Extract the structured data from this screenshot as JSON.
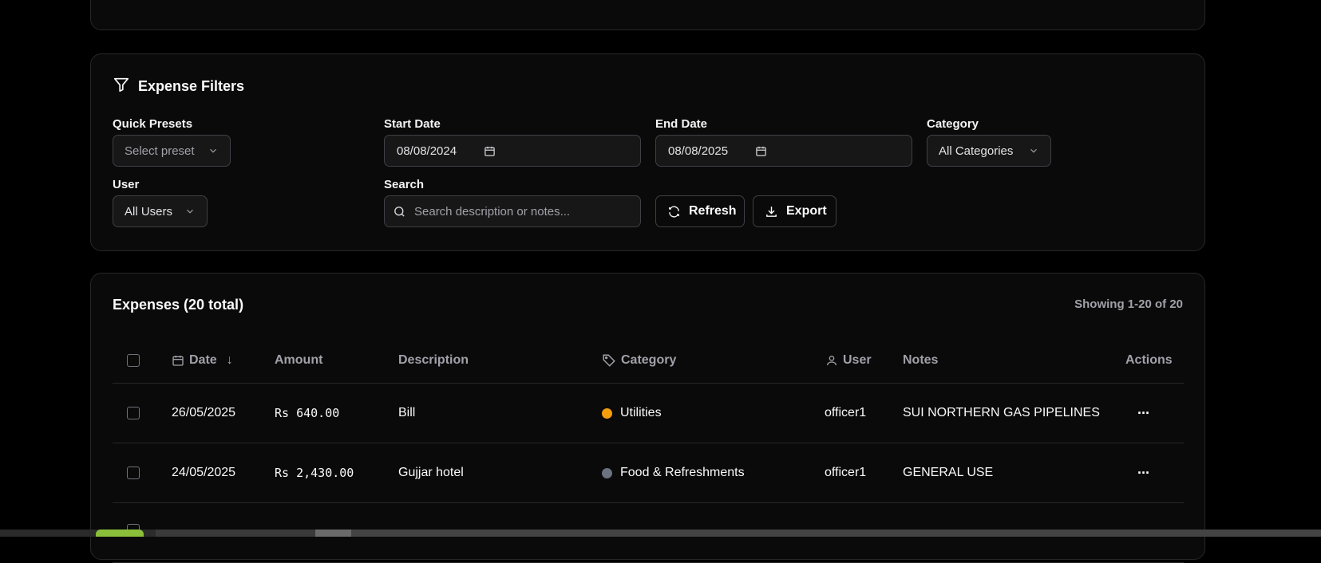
{
  "top_fragment": "",
  "filters": {
    "title": "Expense Filters",
    "quick_presets_label": "Quick Presets",
    "quick_presets_placeholder": "Select preset",
    "start_date_label": "Start Date",
    "start_date_value": "08/08/2024",
    "end_date_label": "End Date",
    "end_date_value": "08/08/2025",
    "category_label": "Category",
    "category_value": "All Categories",
    "user_label": "User",
    "user_value": "All Users",
    "search_label": "Search",
    "search_placeholder": "Search description or notes...",
    "refresh_label": "Refresh",
    "export_label": "Export"
  },
  "expenses": {
    "title": "Expenses (20 total)",
    "showing": "Showing 1-20 of 20",
    "columns": {
      "date": "Date",
      "sort_indicator": "↓",
      "amount": "Amount",
      "description": "Description",
      "category": "Category",
      "user": "User",
      "notes": "Notes",
      "actions": "Actions"
    },
    "rows": [
      {
        "date": "26/05/2025",
        "amount": "Rs 640.00",
        "description": "Bill",
        "category": "Utilities",
        "category_color": "#f59e0b",
        "user": "officer1",
        "notes": "SUI NORTHERN GAS PIPELINES",
        "actions": "···"
      },
      {
        "date": "24/05/2025",
        "amount": "Rs 2,430.00",
        "description": "Gujjar hotel",
        "category": "Food & Refreshments",
        "category_color": "#6b7280",
        "user": "officer1",
        "notes": "GENERAL USE",
        "actions": "···"
      }
    ]
  },
  "icons": {
    "filter": "filter-icon",
    "calendar": "calendar-icon",
    "chevron": "chevron-down-icon",
    "search": "search-icon",
    "refresh": "refresh-icon",
    "download": "download-icon",
    "tag": "tag-icon",
    "user": "user-icon",
    "more": "more-horizontal-icon"
  }
}
